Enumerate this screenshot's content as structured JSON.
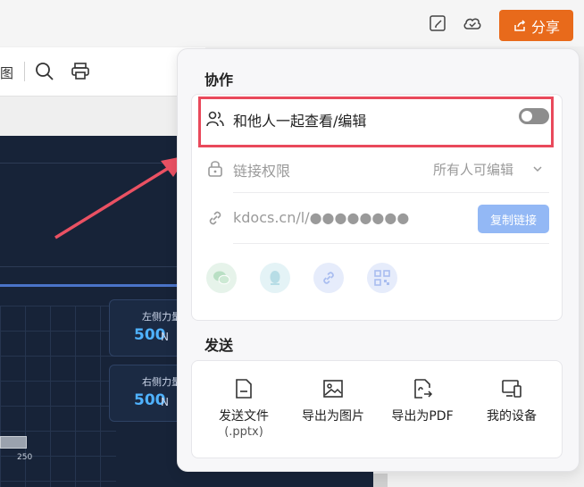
{
  "topbar": {
    "share_label": "分享",
    "icons": [
      "edit-doc-icon",
      "cloud-check-icon",
      "share-icon"
    ],
    "accent_color": "#e86a1b"
  },
  "toolbar": {
    "fragment_label": "图",
    "icons": [
      "search-icon",
      "printer-icon"
    ]
  },
  "slide": {
    "left_force_label": "左侧力量",
    "left_force_value": "500",
    "left_force_unit": "N",
    "right_force_label": "右侧力量",
    "right_force_value": "500",
    "right_force_unit": "N",
    "axis_tick": "250"
  },
  "panel": {
    "collab_title": "协作",
    "collab_toggle_label": "和他人一起查看/编辑",
    "collab_toggle_on": false,
    "permission_label": "链接权限",
    "permission_value": "所有人可编辑",
    "link_text": "kdocs.cn/l/●●●●●●●●",
    "copy_link_label": "复制链接",
    "share_targets": [
      "wechat-icon",
      "qq-icon",
      "link-icon",
      "qrcode-icon"
    ],
    "send_title": "发送",
    "send_items": [
      {
        "label": "发送文件",
        "sub": "(.pptx)",
        "icon": "file-icon"
      },
      {
        "label": "导出为图片",
        "sub": "",
        "icon": "image-icon"
      },
      {
        "label": "导出为PDF",
        "sub": "",
        "icon": "export-pdf-icon"
      },
      {
        "label": "我的设备",
        "sub": "",
        "icon": "devices-icon"
      }
    ],
    "highlight_color": "#e9495b",
    "copy_button_color": "#93b8f5"
  }
}
